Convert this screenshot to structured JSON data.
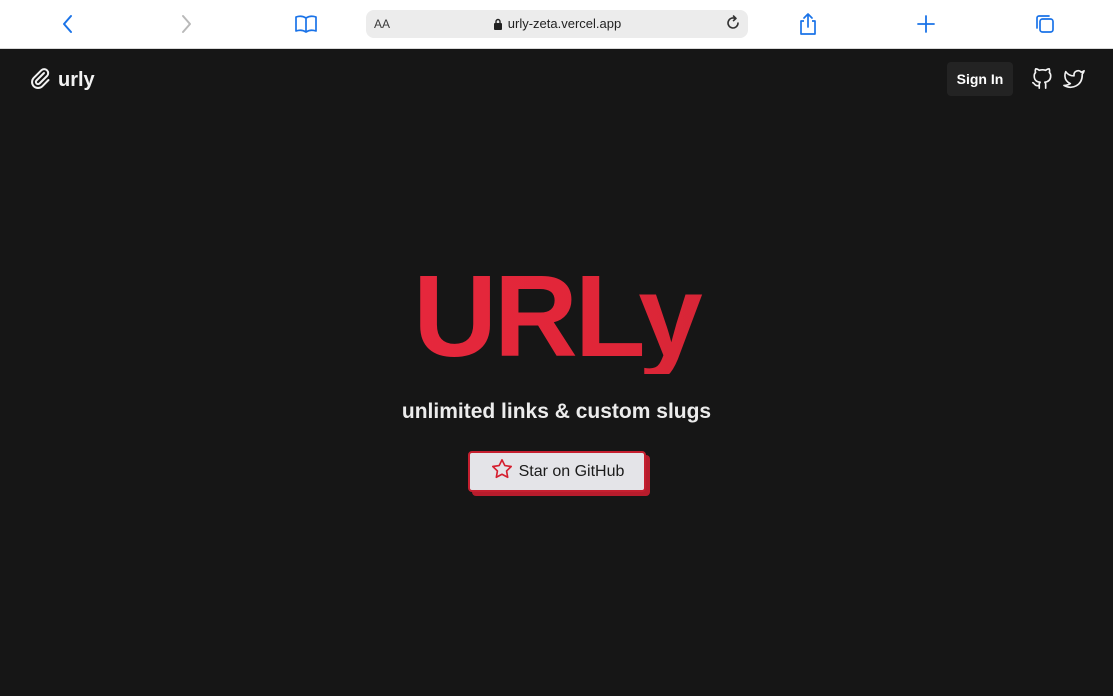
{
  "browser": {
    "address_aa": "AA",
    "url": "urly-zeta.vercel.app",
    "icons": [
      "back-icon",
      "forward-icon",
      "bookmarks-icon",
      "lock-icon",
      "reload-icon",
      "share-icon",
      "new-tab-icon",
      "tabs-icon"
    ]
  },
  "header": {
    "logo_text": "urly",
    "logo_icon": "paperclip-icon",
    "signin_label": "Sign In",
    "social_icons": [
      "github-icon",
      "twitter-icon"
    ]
  },
  "hero": {
    "title": "URLy",
    "subtitle": "unlimited links & custom slugs",
    "star_button_label": "Star on GitHub",
    "star_icon": "star-icon"
  },
  "colors": {
    "background": "#161616",
    "accent": "#e02638",
    "safari_blue": "#1a73e8"
  }
}
